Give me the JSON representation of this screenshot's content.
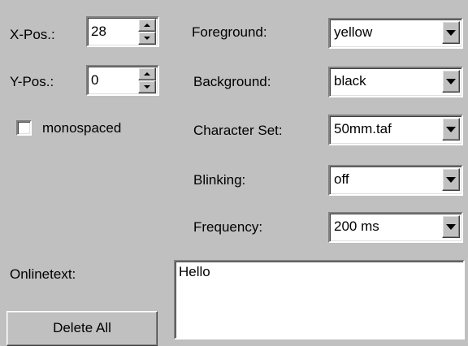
{
  "xpos": {
    "label": "X-Pos.:",
    "value": "28"
  },
  "ypos": {
    "label": "Y-Pos.:",
    "value": "0"
  },
  "monospaced": {
    "label": "monospaced",
    "checked": false
  },
  "foreground": {
    "label": "Foreground:",
    "value": "yellow"
  },
  "background": {
    "label": "Background:",
    "value": "black"
  },
  "charset": {
    "label": "Character Set:",
    "value": "50mm.taf"
  },
  "blinking": {
    "label": "Blinking:",
    "value": "off"
  },
  "frequency": {
    "label": "Frequency:",
    "value": "200 ms"
  },
  "onlinetext": {
    "label": "Onlinetext:",
    "value": "Hello"
  },
  "delete_all": {
    "label": "Delete All"
  },
  "icons": {
    "spin_up": "chevron-up-icon",
    "spin_down": "chevron-down-icon",
    "dropdown": "dropdown-arrow-icon"
  }
}
